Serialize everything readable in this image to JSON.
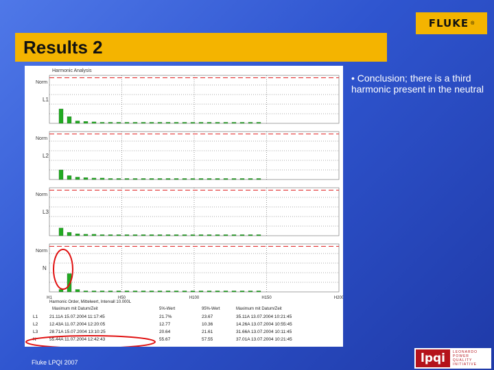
{
  "brand": {
    "name": "FLUKE",
    "mark": "®"
  },
  "slide": {
    "title": "Results 2",
    "bullet": "• Conclusion; there is a third harmonic present in the neutral"
  },
  "footer": "Fluke LPQI 2007",
  "partner_logo": {
    "mark": "lpqi",
    "lines": [
      "LEONARDO",
      "POWER",
      "QUALITY",
      "INITIATIVE"
    ]
  },
  "colors": {
    "brand_yellow": "#f4b400",
    "slide_blue": "#2f55cf",
    "bar_green": "#22aa22",
    "highlight_red": "#e01010",
    "limit_red": "#e02020"
  },
  "screenshot": {
    "header": "Harmonic Analysis",
    "panel_label_y": "Norm",
    "panel_names": [
      "L1",
      "L2",
      "L3",
      "N"
    ],
    "x_ticks": [
      "H1",
      "H50",
      "H100",
      "H150",
      "H200"
    ],
    "caption": "Harmonic Order, Mittelwert, Intervall 10.000L",
    "table": {
      "headers": [
        "Maximum mit Datum/Zeit",
        "5%-Wert",
        "95%-Wert",
        "Maximum mit Datum/Zeit"
      ],
      "rows": [
        {
          "label": "L1",
          "max1": "21.11A 15.07.2004 11:17:45",
          "p5": "21.7%",
          "p95": "23.67",
          "max2": "35.11A 13.07.2004 10:21:45"
        },
        {
          "label": "L2",
          "max1": "12.43A 11.07.2004 12:20:05",
          "p5": "12.77",
          "p95": "10.36",
          "max2": "14.26A 13.07.2004 10:55:45"
        },
        {
          "label": "L3",
          "max1": "28.71A 15.07.2004 13:10:25",
          "p5": "20.64",
          "p95": "21.61",
          "max2": "31.66A 13.07.2004 10:11:45"
        },
        {
          "label": "N",
          "max1": "55.44A 11.07.2004 12:42:43",
          "p5": "55.67",
          "p95": "57.55",
          "max2": "37.01A 13.07.2004 10:21:45"
        }
      ]
    }
  },
  "chart_data": [
    {
      "type": "bar",
      "name": "L1",
      "x": [
        1,
        2,
        3,
        4,
        5,
        6,
        7,
        8,
        9,
        10,
        11,
        12,
        13,
        14,
        15,
        16,
        17,
        18,
        19,
        20,
        21,
        22,
        23,
        24,
        25
      ],
      "values": [
        0.3,
        0.14,
        0.05,
        0.04,
        0.03,
        0.02,
        0.02,
        0.02,
        0.015,
        0.015,
        0.015,
        0.01,
        0.01,
        0.01,
        0.01,
        0.01,
        0.01,
        0.01,
        0.01,
        0.01,
        0.01,
        0.01,
        0.01,
        0.01,
        0.01
      ],
      "limit": 0.95,
      "ylim": [
        0,
        1
      ]
    },
    {
      "type": "bar",
      "name": "L2",
      "x": [
        1,
        2,
        3,
        4,
        5,
        6,
        7,
        8,
        9,
        10,
        11,
        12,
        13,
        14,
        15,
        16,
        17,
        18,
        19,
        20,
        21,
        22,
        23,
        24,
        25
      ],
      "values": [
        0.2,
        0.08,
        0.05,
        0.04,
        0.03,
        0.03,
        0.02,
        0.02,
        0.02,
        0.02,
        0.02,
        0.02,
        0.02,
        0.02,
        0.02,
        0.02,
        0.02,
        0.02,
        0.02,
        0.02,
        0.02,
        0.02,
        0.02,
        0.02,
        0.02
      ],
      "limit": 0.95,
      "ylim": [
        0,
        1
      ]
    },
    {
      "type": "bar",
      "name": "L3",
      "x": [
        1,
        2,
        3,
        4,
        5,
        6,
        7,
        8,
        9,
        10,
        11,
        12,
        13,
        14,
        15,
        16,
        17,
        18,
        19,
        20,
        21,
        22,
        23,
        24,
        25
      ],
      "values": [
        0.16,
        0.07,
        0.04,
        0.03,
        0.03,
        0.02,
        0.02,
        0.02,
        0.02,
        0.02,
        0.02,
        0.02,
        0.02,
        0.02,
        0.02,
        0.02,
        0.02,
        0.02,
        0.02,
        0.02,
        0.02,
        0.02,
        0.02,
        0.02,
        0.02
      ],
      "limit": 0.95,
      "ylim": [
        0,
        1
      ]
    },
    {
      "type": "bar",
      "name": "N",
      "x": [
        1,
        2,
        3,
        4,
        5,
        6,
        7,
        8,
        9,
        10,
        11,
        12,
        13,
        14,
        15,
        16,
        17,
        18,
        19,
        20,
        21,
        22,
        23,
        24,
        25
      ],
      "values": [
        0.05,
        0.38,
        0.05,
        0.02,
        0.02,
        0.01,
        0.01,
        0.01,
        0.01,
        0.01,
        0.01,
        0.01,
        0.01,
        0.01,
        0.01,
        0.01,
        0.01,
        0.01,
        0.01,
        0.01,
        0.01,
        0.01,
        0.01,
        0.01,
        0.01
      ],
      "limit": 0.95,
      "ylim": [
        0,
        1
      ]
    }
  ]
}
